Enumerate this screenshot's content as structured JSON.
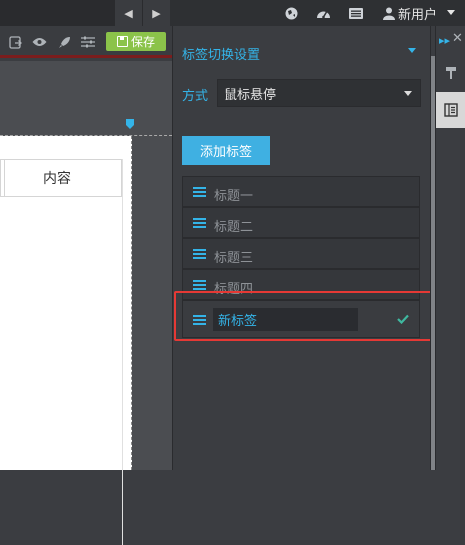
{
  "topbar": {
    "nav_prev": "◀",
    "nav_next": "▶",
    "icons": [
      "globe-icon",
      "dashboard-icon",
      "list-icon",
      "user-icon"
    ],
    "user_label": "新用户"
  },
  "toolbar": {
    "save_label": "保存",
    "icons": [
      "export-icon",
      "preview-icon",
      "rocket-icon",
      "sliders-icon"
    ]
  },
  "canvas": {
    "table_cell_content": "内容"
  },
  "panel": {
    "title": "标签切换设置",
    "mode_label": "方式",
    "mode_value": "鼠标悬停",
    "add_tab_label": "添加标签",
    "tabs": [
      {
        "label": "标题一"
      },
      {
        "label": "标题二"
      },
      {
        "label": "标题三"
      },
      {
        "label": "标题四"
      }
    ],
    "new_tab_value": "新标签"
  },
  "colors": {
    "accent": "#34b4e8",
    "save": "#8bc34a",
    "highlight": "#e53935"
  }
}
